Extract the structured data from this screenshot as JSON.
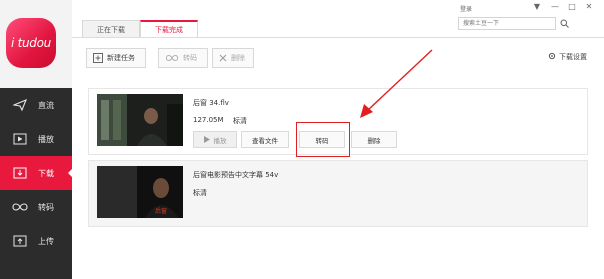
{
  "app": {
    "logo_text": "i tudou",
    "brand_color": "#e8193c"
  },
  "sidebar": {
    "items": [
      {
        "label": "直流",
        "icon": "paper-plane-icon"
      },
      {
        "label": "播放",
        "icon": "play-icon"
      },
      {
        "label": "下载",
        "icon": "download-icon"
      },
      {
        "label": "转码",
        "icon": "infinity-icon"
      },
      {
        "label": "上传",
        "icon": "upload-icon"
      }
    ],
    "active_index": 2
  },
  "tabs": [
    {
      "label": "正在下载"
    },
    {
      "label": "下载完成"
    }
  ],
  "header": {
    "login_label": "登录",
    "search_placeholder": "搜索土豆一下",
    "window_controls": [
      "▼",
      "—",
      "□",
      "✕"
    ]
  },
  "toolbar": {
    "new_task": "新建任务",
    "convert": "转码",
    "delete": "删除",
    "settings": "下载设置"
  },
  "items": [
    {
      "title": "后窗 34.flv",
      "size": "127.05M",
      "quality": "标清",
      "actions": [
        "播放",
        "查看文件",
        "转码",
        "删除"
      ]
    },
    {
      "title": "后窗电影预告中文字幕 54v",
      "quality": "标清",
      "thumb_caption": "后窗"
    }
  ],
  "annotation": {
    "color": "#e02020"
  }
}
